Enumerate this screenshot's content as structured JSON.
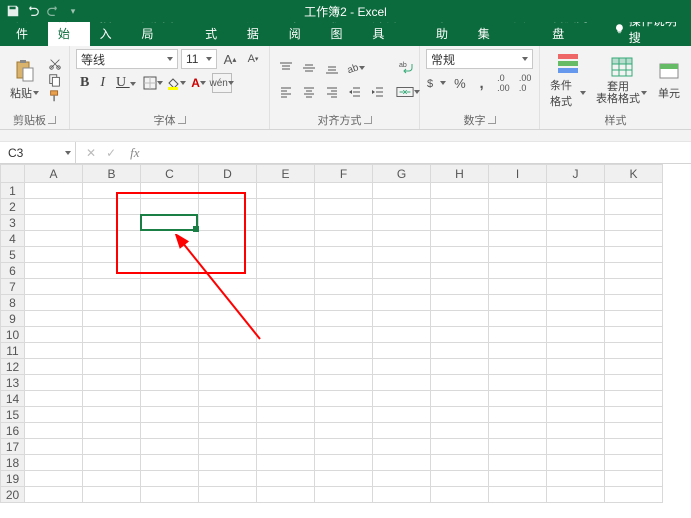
{
  "titlebar": {
    "title": "工作簿2 - Excel"
  },
  "tabs": {
    "file": "文件",
    "home": "开始",
    "insert": "插入",
    "layout": "页面布局",
    "formulas": "公式",
    "data": "数据",
    "review": "审阅",
    "view": "视图",
    "dev": "开发工具",
    "help": "帮助",
    "pdf": "PDF工具集",
    "baidu": "百度网盘",
    "tellme": "操作说明搜"
  },
  "ribbon": {
    "clipboard": {
      "paste": "粘贴",
      "label": "剪贴板"
    },
    "font": {
      "name": "等线",
      "size": "11",
      "phonetic": "wén",
      "label": "字体"
    },
    "align": {
      "label": "对齐方式"
    },
    "number": {
      "format": "常规",
      "label": "数字"
    },
    "styles": {
      "cond": "条件格式",
      "table": "套用\n表格格式",
      "cell": "单元",
      "label": "样式"
    }
  },
  "namebox": {
    "ref": "C3"
  },
  "grid": {
    "cols": [
      "A",
      "B",
      "C",
      "D",
      "E",
      "F",
      "G",
      "H",
      "I",
      "J",
      "K"
    ],
    "rows": [
      "1",
      "2",
      "3",
      "4",
      "5",
      "6",
      "7",
      "8",
      "9",
      "10",
      "11",
      "12",
      "13",
      "14",
      "15",
      "16",
      "17",
      "18",
      "19",
      "20"
    ]
  }
}
